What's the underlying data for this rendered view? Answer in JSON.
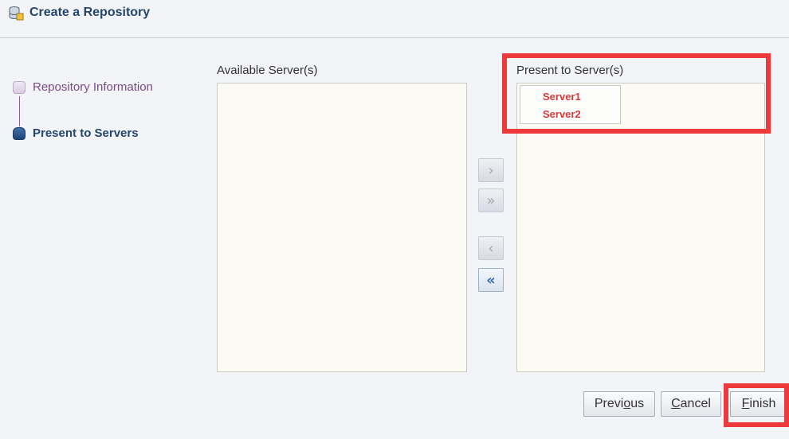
{
  "window": {
    "title": "Create a Repository",
    "icon": "database-create-icon"
  },
  "train": {
    "steps": [
      {
        "label": "Repository Information",
        "state": "visited"
      },
      {
        "label": "Present to Servers",
        "state": "current"
      }
    ]
  },
  "shuttle": {
    "available_label": "Available Server(s)",
    "available_items": [],
    "present_label": "Present to Server(s)",
    "present_items": [
      "Server1",
      "Server2"
    ],
    "buttons": {
      "move": "›",
      "move_all": "»",
      "remove": "‹",
      "remove_all": "«"
    }
  },
  "footer": {
    "previous": {
      "pre": "Previ",
      "accel": "o",
      "post": "us"
    },
    "cancel": {
      "pre": "",
      "accel": "C",
      "post": "ancel"
    },
    "finish": {
      "pre": "",
      "accel": "F",
      "post": "inish"
    }
  },
  "colors": {
    "highlight": "#ee3a3a",
    "server_item": "#d83a3a",
    "title": "#24456c",
    "visited_step": "#7a4a87"
  }
}
